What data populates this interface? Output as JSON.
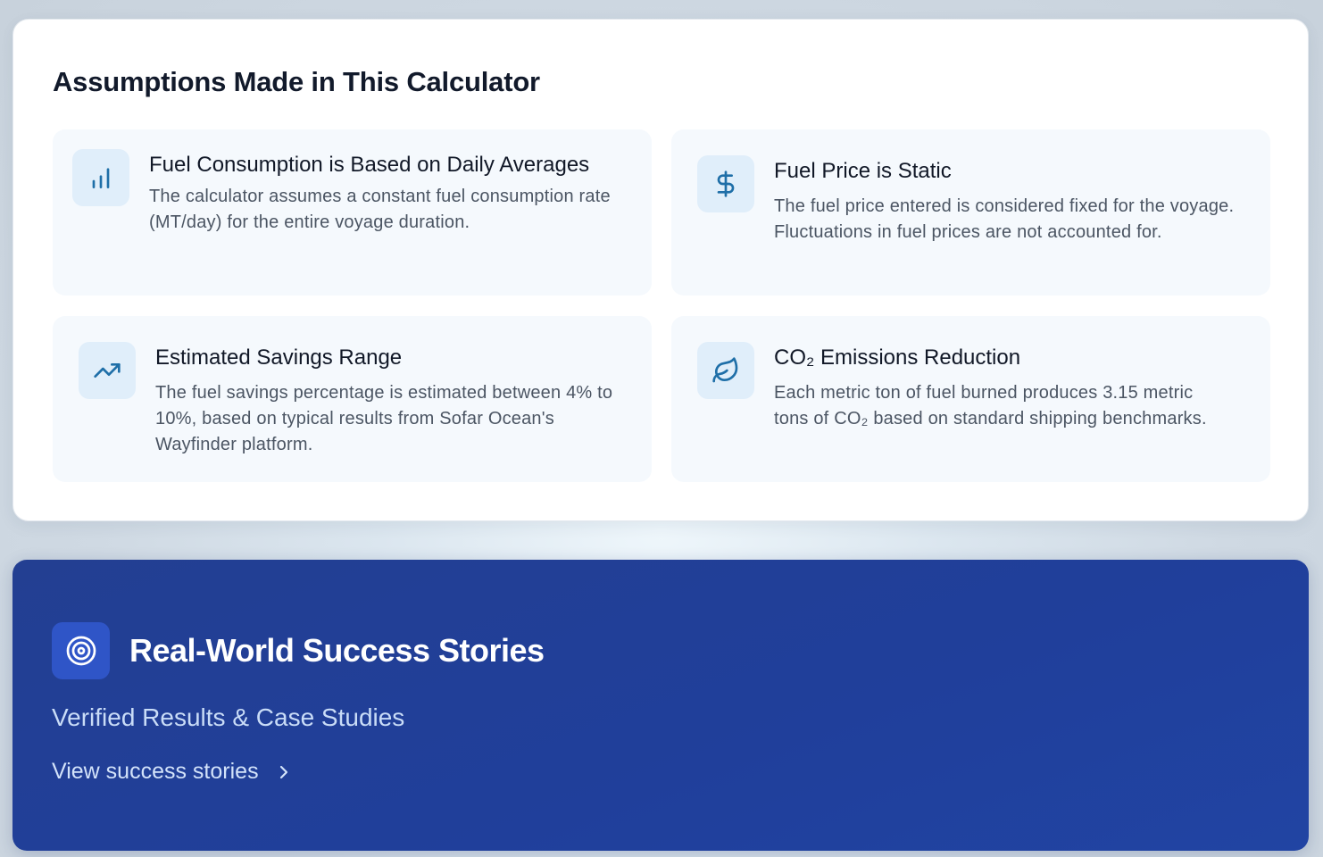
{
  "assumptions": {
    "title": "Assumptions Made in This Calculator",
    "items": [
      {
        "icon": "bar-chart-icon",
        "title": "Fuel Consumption is Based on Daily Averages",
        "description": "The calculator assumes a constant fuel consumption rate (MT/day) for the entire voyage duration."
      },
      {
        "icon": "dollar-sign-icon",
        "title": "Fuel Price is Static",
        "description": "The fuel price entered is considered fixed for the voyage. Fluctuations in fuel prices are not accounted for."
      },
      {
        "icon": "trending-up-icon",
        "title": "Estimated Savings Range",
        "description": "The fuel savings percentage is estimated between 4% to 10%, based on typical results from Sofar Ocean's Wayfinder platform."
      },
      {
        "icon": "leaf-icon",
        "title": "CO₂ Emissions Reduction",
        "description": "Each metric ton of fuel burned produces 3.15 metric tons of CO₂ based on standard shipping benchmarks."
      }
    ]
  },
  "stories": {
    "icon": "target-icon",
    "title": "Real-World Success Stories",
    "subtitle": "Verified Results & Case Studies",
    "link_label": "View success stories",
    "link_icon": "chevron-right-icon"
  },
  "colors": {
    "accent": "#1f6fa8",
    "icon_bg": "#e0eefa",
    "banner_bg": "#203f9b",
    "banner_icon_bg": "#2f55c7"
  }
}
